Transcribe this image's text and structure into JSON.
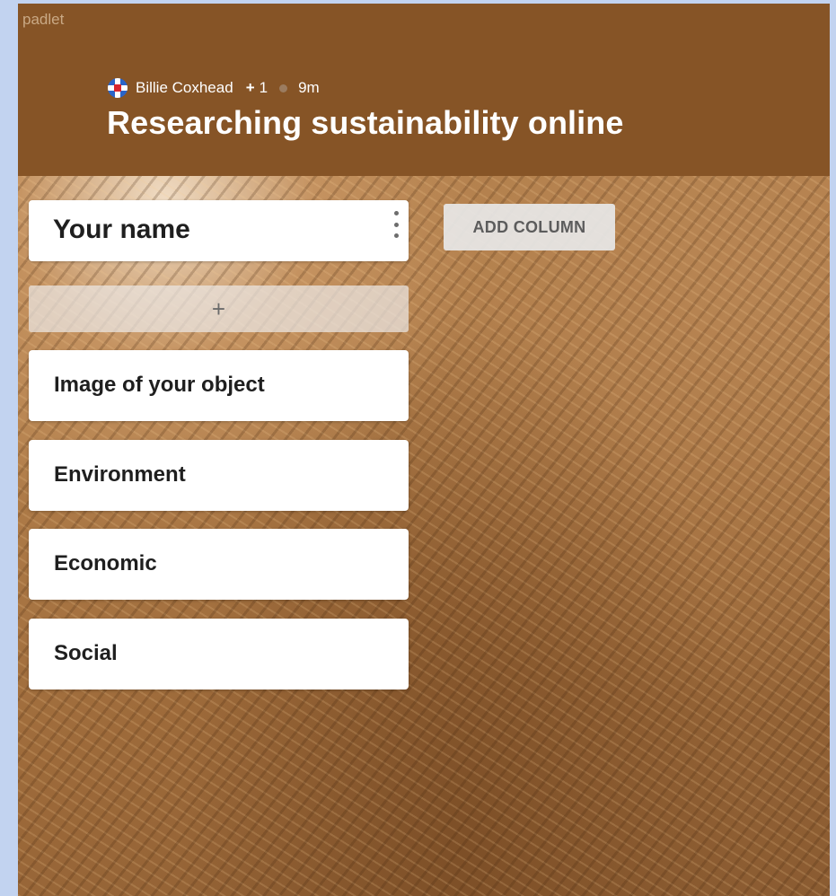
{
  "app": {
    "brand": "padlet"
  },
  "header": {
    "author": "Billie Coxhead",
    "plus_label": "+",
    "plus_count": "1",
    "elapsed": "9m",
    "title": "Researching sustainability online",
    "background_color": "#865426"
  },
  "column": {
    "title": "Your name",
    "add_post_label": "+",
    "posts": [
      {
        "title": "Image of your object"
      },
      {
        "title": "Environment"
      },
      {
        "title": "Economic"
      },
      {
        "title": "Social"
      }
    ]
  },
  "toolbar": {
    "add_column_label": "ADD COLUMN"
  },
  "icons": {
    "avatar": "flag-avatar-icon",
    "column_menu": "kebab-menu-icon"
  }
}
